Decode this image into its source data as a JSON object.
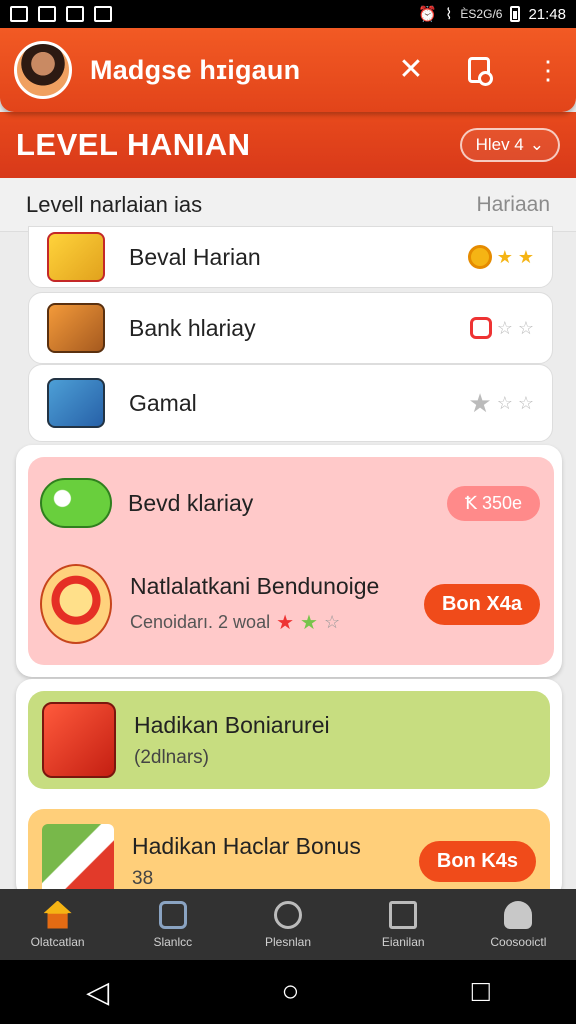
{
  "status_bar": {
    "small_text": "ÈS2G/6",
    "time": "21:48"
  },
  "app_header": {
    "title": "Madgse hɪigaun",
    "close_glyph": "✕",
    "dots_glyph": "⋮"
  },
  "level_header": {
    "title": "LEVEL HANIAN",
    "select_label": "Hlev 4",
    "select_chevron": "⌄"
  },
  "subheader": {
    "left": "Levell narlaian ias",
    "right": "Hariaan"
  },
  "list_items": [
    {
      "label": "Beval Harian",
      "icon": "gift-box-icon"
    },
    {
      "label": "Bank hlariay",
      "icon": "safe-icon"
    },
    {
      "label": "Gamal",
      "icon": "backpack-icon"
    }
  ],
  "highlight": {
    "title1": "Bevd klariay",
    "pill1": "Ꝁ 350e",
    "title2": "Natlalatkani Bendunoige",
    "sub": "Cenoidarı. 2  woal",
    "button": "Bon X4a"
  },
  "lower": {
    "green_title": "Hadikan Boniarurei",
    "green_sub": "(2dlnars)",
    "orange_title": "Hadikan Haclar Bonus",
    "orange_sub": "38",
    "orange_button": "Bon K4s"
  },
  "bottom_nav": [
    {
      "label": "Olatcatlan",
      "icon": "home-icon"
    },
    {
      "label": "Slanlcc",
      "icon": "ticket-icon"
    },
    {
      "label": "Plesnlan",
      "icon": "compass-icon"
    },
    {
      "label": "Eianilan",
      "icon": "list-icon"
    },
    {
      "label": "Coosooictl",
      "icon": "user-icon"
    }
  ],
  "system_nav": {
    "back_glyph": "◁",
    "home_glyph": "○",
    "recents_glyph": "□"
  },
  "colors": {
    "header": "#e84a1c",
    "highlight_bg": "#ffc9c9",
    "green_bg": "#c7dd80",
    "orange_bg": "#ffcf7a"
  }
}
